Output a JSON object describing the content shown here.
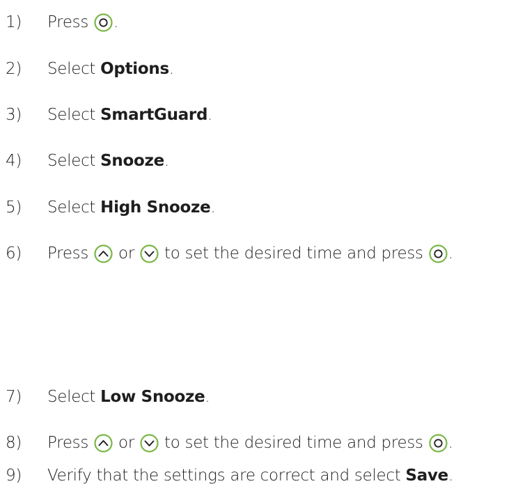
{
  "colors": {
    "text": "#1e1e1e",
    "button_ring": "#7ab648"
  },
  "steps": [
    {
      "num": "1)",
      "parts": [
        {
          "t": "text",
          "v": "Press "
        },
        {
          "t": "icon",
          "icon": "select-button-icon"
        },
        {
          "t": "text",
          "v": "."
        }
      ]
    },
    {
      "num": "2)",
      "parts": [
        {
          "t": "text",
          "v": "Select "
        },
        {
          "t": "bold",
          "v": "Options"
        },
        {
          "t": "text",
          "v": "."
        }
      ]
    },
    {
      "num": "3)",
      "parts": [
        {
          "t": "text",
          "v": "Select "
        },
        {
          "t": "bold",
          "v": "SmartGuard"
        },
        {
          "t": "text",
          "v": "."
        }
      ]
    },
    {
      "num": "4)",
      "parts": [
        {
          "t": "text",
          "v": "Select "
        },
        {
          "t": "bold",
          "v": "Snooze"
        },
        {
          "t": "text",
          "v": "."
        }
      ]
    },
    {
      "num": "5)",
      "parts": [
        {
          "t": "text",
          "v": "Select "
        },
        {
          "t": "bold",
          "v": "High Snooze"
        },
        {
          "t": "text",
          "v": "."
        }
      ]
    },
    {
      "num": "6)",
      "parts": [
        {
          "t": "text",
          "v": "Press "
        },
        {
          "t": "icon",
          "icon": "up-button-icon"
        },
        {
          "t": "text",
          "v": " or "
        },
        {
          "t": "icon",
          "icon": "down-button-icon"
        },
        {
          "t": "text",
          "v": " to set the desired time and press "
        },
        {
          "t": "icon",
          "icon": "select-button-icon"
        },
        {
          "t": "text",
          "v": "."
        }
      ]
    },
    {
      "num": "7)",
      "parts": [
        {
          "t": "text",
          "v": "Select "
        },
        {
          "t": "bold",
          "v": "Low Snooze"
        },
        {
          "t": "text",
          "v": "."
        }
      ]
    },
    {
      "num": "8)",
      "parts": [
        {
          "t": "text",
          "v": "Press "
        },
        {
          "t": "icon",
          "icon": "up-button-icon"
        },
        {
          "t": "text",
          "v": " or "
        },
        {
          "t": "icon",
          "icon": "down-button-icon"
        },
        {
          "t": "text",
          "v": " to set the desired time and press "
        },
        {
          "t": "icon",
          "icon": "select-button-icon"
        },
        {
          "t": "text",
          "v": "."
        }
      ]
    },
    {
      "num": "9)",
      "parts": [
        {
          "t": "text",
          "v": "Verify that the settings are correct and select "
        },
        {
          "t": "bold",
          "v": "Save"
        },
        {
          "t": "text",
          "v": "."
        }
      ]
    }
  ]
}
